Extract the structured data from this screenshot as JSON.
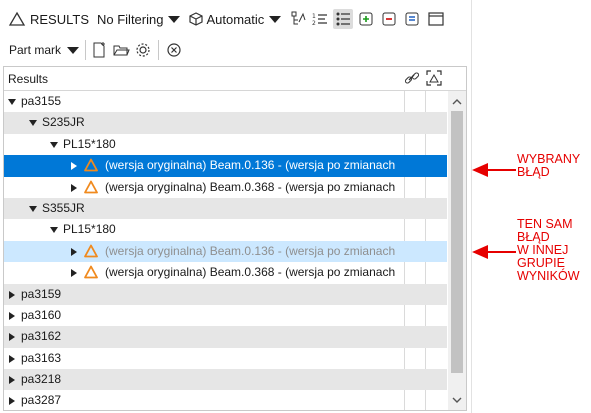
{
  "toolbar": {
    "results_label": "RESULTS",
    "filter_value": "No Filtering",
    "mode_value": "Automatic",
    "part_mark_label": "Part mark"
  },
  "table": {
    "header": "Results",
    "rows": [
      {
        "label": "pa3155"
      },
      {
        "label": "S235JR"
      },
      {
        "label": "PL15*180"
      },
      {
        "label": "(wersja oryginalna) Beam.0.136 - (wersja po zmianach"
      },
      {
        "label": "(wersja oryginalna) Beam.0.368 - (wersja po zmianach"
      },
      {
        "label": "S355JR"
      },
      {
        "label": "PL15*180"
      },
      {
        "label": "(wersja oryginalna) Beam.0.136 - (wersja po zmianach"
      },
      {
        "label": "(wersja oryginalna) Beam.0.368 - (wersja po zmianach"
      },
      {
        "label": "pa3159"
      },
      {
        "label": "pa3160"
      },
      {
        "label": "pa3162"
      },
      {
        "label": "pa3163"
      },
      {
        "label": "pa3218"
      },
      {
        "label": "pa3287"
      }
    ]
  },
  "annotations": {
    "selected_error": [
      "WYBRANY",
      "BŁĄD"
    ],
    "same_error": [
      "TEN SAM",
      "BŁĄD",
      "W INNEJ",
      "GRUPIE",
      "WYNIKÓW"
    ]
  },
  "colors": {
    "selection": "#0078d7",
    "secondary_selection": "#cce8ff",
    "warning_icon": "#f08a1e",
    "annotation": "#e60000"
  }
}
